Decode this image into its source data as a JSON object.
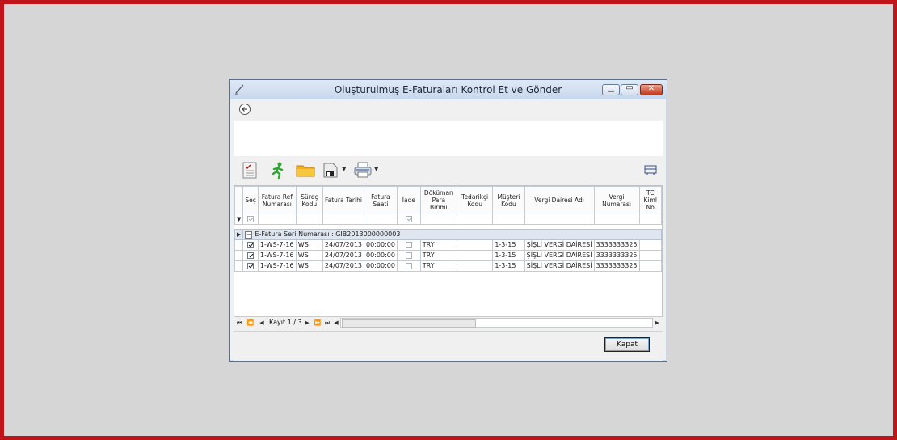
{
  "window": {
    "title": "Oluşturulmuş E-Faturaları Kontrol Et ve Gönder"
  },
  "toolbar": {
    "icons": [
      "checklist-icon",
      "run-icon",
      "folder-icon",
      "save-icon",
      "print-icon",
      "layout-icon"
    ]
  },
  "grid": {
    "columns": [
      "Seç",
      "Fatura Ref Numarası",
      "Süreç Kodu",
      "Fatura Tarihi",
      "Fatura Saati",
      "İade",
      "Döküman Para Birimi",
      "Tedarikçi Kodu",
      "Müşteri Kodu",
      "Vergi Dairesi Adı",
      "Vergi Numarası",
      "TC Kiml No"
    ],
    "group_label": "E-Fatura Seri Numarası : GIB2013000000003",
    "rows": [
      {
        "ref": "1-WS-7-16",
        "surec": "WS",
        "tarih": "24/07/2013",
        "saat": "00:00:00",
        "para": "TRY",
        "tedarikci": "",
        "musteri": "1-3-15",
        "vergi_dairesi": "ŞİŞLİ VERGİ DAİRESİ",
        "vergi_no": "3333333325",
        "tc": ""
      },
      {
        "ref": "1-WS-7-16",
        "surec": "WS",
        "tarih": "24/07/2013",
        "saat": "00:00:00",
        "para": "TRY",
        "tedarikci": "",
        "musteri": "1-3-15",
        "vergi_dairesi": "ŞİŞLİ VERGİ DAİRESİ",
        "vergi_no": "3333333325",
        "tc": ""
      },
      {
        "ref": "1-WS-7-16",
        "surec": "WS",
        "tarih": "24/07/2013",
        "saat": "00:00:00",
        "para": "TRY",
        "tedarikci": "",
        "musteri": "1-3-15",
        "vergi_dairesi": "ŞİŞLİ VERGİ DAİRESİ",
        "vergi_no": "3333333325",
        "tc": ""
      }
    ]
  },
  "navigator": {
    "record_text": "Kayıt 1 / 3"
  },
  "footer": {
    "close_label": "Kapat"
  }
}
